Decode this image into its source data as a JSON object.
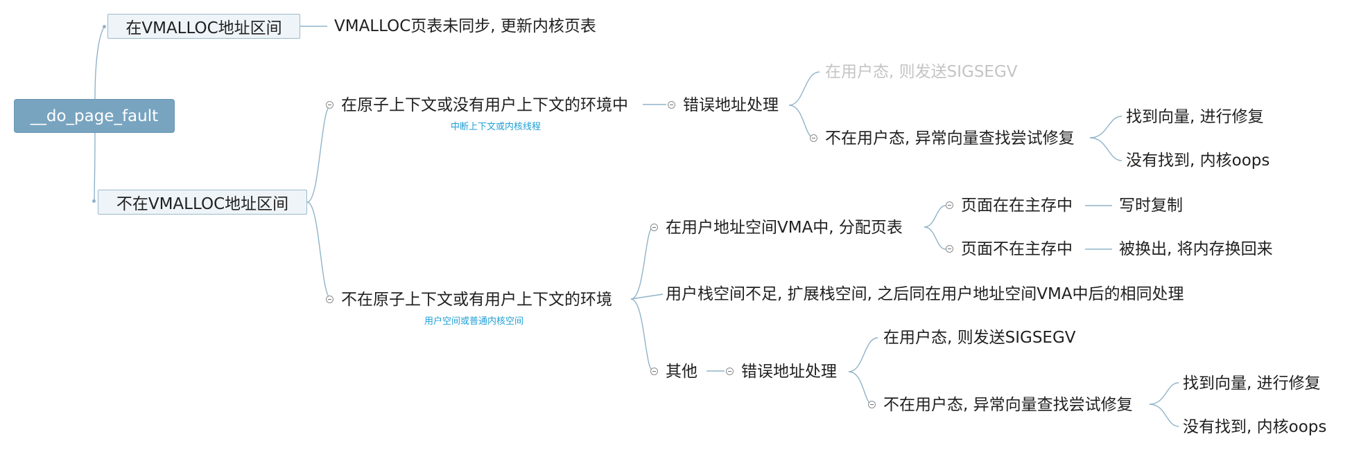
{
  "root": {
    "label": "__do_page_fault"
  },
  "branch_vmalloc": {
    "label": "在VMALLOC地址区间",
    "child": "VMALLOC页表未同步, 更新内核页表"
  },
  "branch_not_vmalloc": {
    "label": "不在VMALLOC地址区间",
    "atomic": {
      "label": "在原子上下文或没有用户上下文的环境中",
      "note": "中断上下文或内核线程",
      "error_handling": "错误地址处理",
      "user_mode": "在用户态, 则发送SIGSEGV",
      "not_user_mode": "不在用户态, 异常向量查找尝试修复",
      "found": "找到向量, 进行修复",
      "not_found": "没有找到, 内核oops"
    },
    "user": {
      "label": "不在原子上下文或有用户上下文的环境",
      "note": "用户空间或普通内核空间",
      "vma": {
        "label": "在用户地址空间VMA中,  分配页表",
        "in_memory": "页面在在主存中",
        "in_memory_child": "写时复制",
        "not_in_memory": "页面不在主存中",
        "not_in_memory_child": "被换出, 将内存换回来"
      },
      "stack": "用户栈空间不足, 扩展栈空间, 之后同在用户地址空间VMA中后的相同处理",
      "other": {
        "label": "其他",
        "error_handling": "错误地址处理",
        "user_mode": "在用户态, 则发送SIGSEGV",
        "not_user_mode": "不在用户态, 异常向量查找尝试修复",
        "found": "找到向量, 进行修复",
        "not_found": "没有找到, 内核oops"
      }
    }
  }
}
